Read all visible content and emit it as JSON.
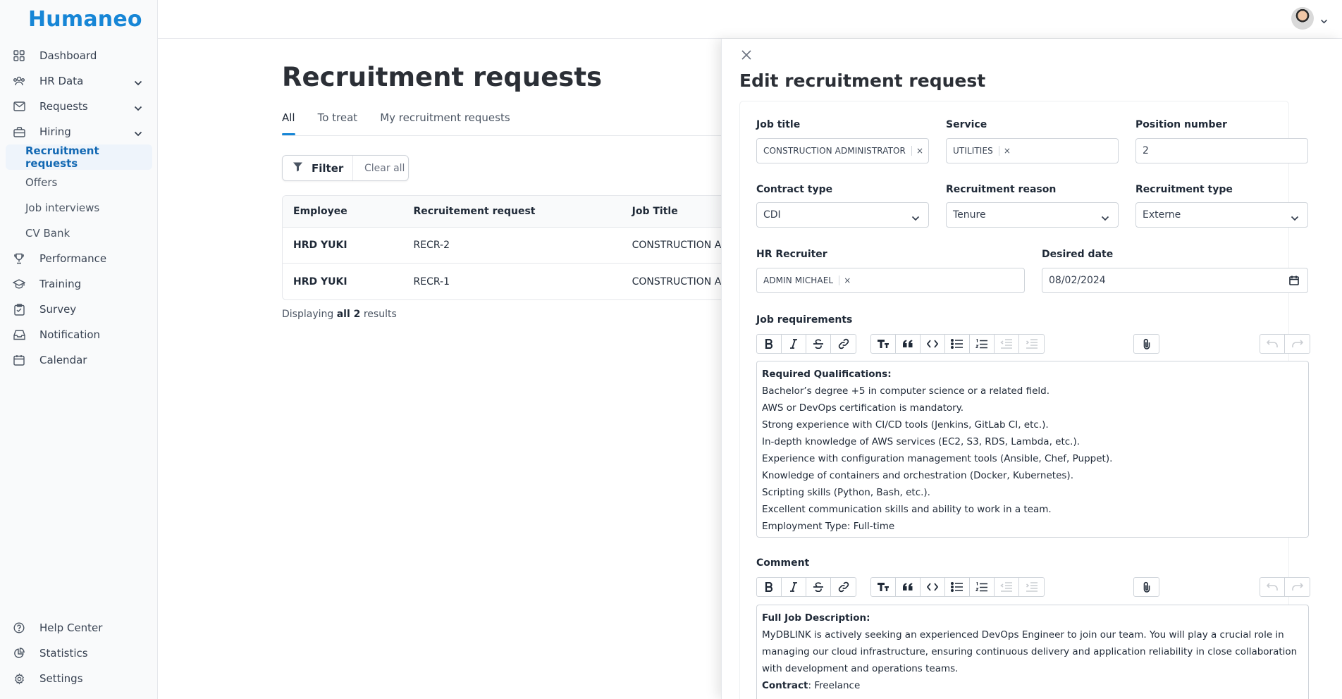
{
  "app": {
    "logo": "Humaneo"
  },
  "sidebar": {
    "items": [
      {
        "label": "Dashboard",
        "icon": "grid-icon"
      },
      {
        "label": "HR Data",
        "icon": "users-icon",
        "expandable": true
      },
      {
        "label": "Requests",
        "icon": "mail-icon",
        "expandable": true
      },
      {
        "label": "Hiring",
        "icon": "briefcase-icon",
        "expandable": true
      }
    ],
    "hiring_sub": [
      {
        "label": "Recruitment requests",
        "active": true
      },
      {
        "label": "Offers"
      },
      {
        "label": "Job interviews"
      },
      {
        "label": "CV Bank"
      }
    ],
    "items_after": [
      {
        "label": "Performance",
        "icon": "trophy-icon"
      },
      {
        "label": "Training",
        "icon": "graduation-icon"
      },
      {
        "label": "Survey",
        "icon": "clipboard-icon"
      },
      {
        "label": "Notification",
        "icon": "inbox-icon"
      },
      {
        "label": "Calendar",
        "icon": "calendar-icon"
      }
    ],
    "bottom": [
      {
        "label": "Help Center",
        "icon": "help-icon"
      },
      {
        "label": "Statistics",
        "icon": "chart-icon"
      },
      {
        "label": "Settings",
        "icon": "gear-icon"
      }
    ]
  },
  "main": {
    "title": "Recruitment requests",
    "tabs": [
      "All",
      "To treat",
      "My recruitment requests"
    ],
    "filter_label": "Filter",
    "clear_label": "Clear all",
    "table": {
      "headers": [
        "Employee",
        "Recruitement request",
        "Job Title"
      ],
      "rows": [
        [
          "HRD YUKI",
          "RECR-2",
          "CONSTRUCTION AD"
        ],
        [
          "HRD YUKI",
          "RECR-1",
          "CONSTRUCTION AD"
        ]
      ]
    },
    "results": {
      "prefix": "Displaying ",
      "bold": "all 2",
      "suffix": " results"
    }
  },
  "drawer": {
    "title": "Edit recruitment request",
    "fields": {
      "job_title": {
        "label": "Job title",
        "value": "CONSTRUCTION ADMINISTRATOR"
      },
      "service": {
        "label": "Service",
        "value": "UTILITIES"
      },
      "position_number": {
        "label": "Position number",
        "value": "2"
      },
      "contract_type": {
        "label": "Contract type",
        "value": "CDI"
      },
      "recruitment_reason": {
        "label": "Recruitment reason",
        "value": "Tenure"
      },
      "recruitment_type": {
        "label": "Recruitment type",
        "value": "Externe"
      },
      "hr_recruiter": {
        "label": "HR Recruiter",
        "value": "ADMIN MICHAEL"
      },
      "desired_date": {
        "label": "Desired date",
        "value": "08/02/2024"
      }
    },
    "remove_glyph": "×",
    "job_requirements": {
      "label": "Job requirements",
      "heading": "Required Qualifications:",
      "lines": [
        "Bachelor’s degree +5 in computer science or a related field.",
        "AWS or DevOps certification is mandatory.",
        "Strong experience with CI/CD tools (Jenkins, GitLab CI, etc.).",
        "In-depth knowledge of AWS services (EC2, S3, RDS, Lambda, etc.).",
        "Experience with configuration management tools (Ansible, Chef, Puppet).",
        "Knowledge of containers and orchestration (Docker, Kubernetes).",
        "Scripting skills (Python, Bash, etc.).",
        "Excellent communication skills and ability to work in a team.",
        "Employment Type: Full-time"
      ]
    },
    "comment": {
      "label": "Comment",
      "heading": "Full Job Description:",
      "paragraph": "MyDBLINK is actively seeking an experienced DevOps Engineer to join our team. You will play a crucial role in managing our cloud infrastructure, ensuring continuous delivery and application reliability in close collaboration with development and operations teams.",
      "contract_label": "Contract",
      "contract_value": ": Freelance"
    }
  }
}
